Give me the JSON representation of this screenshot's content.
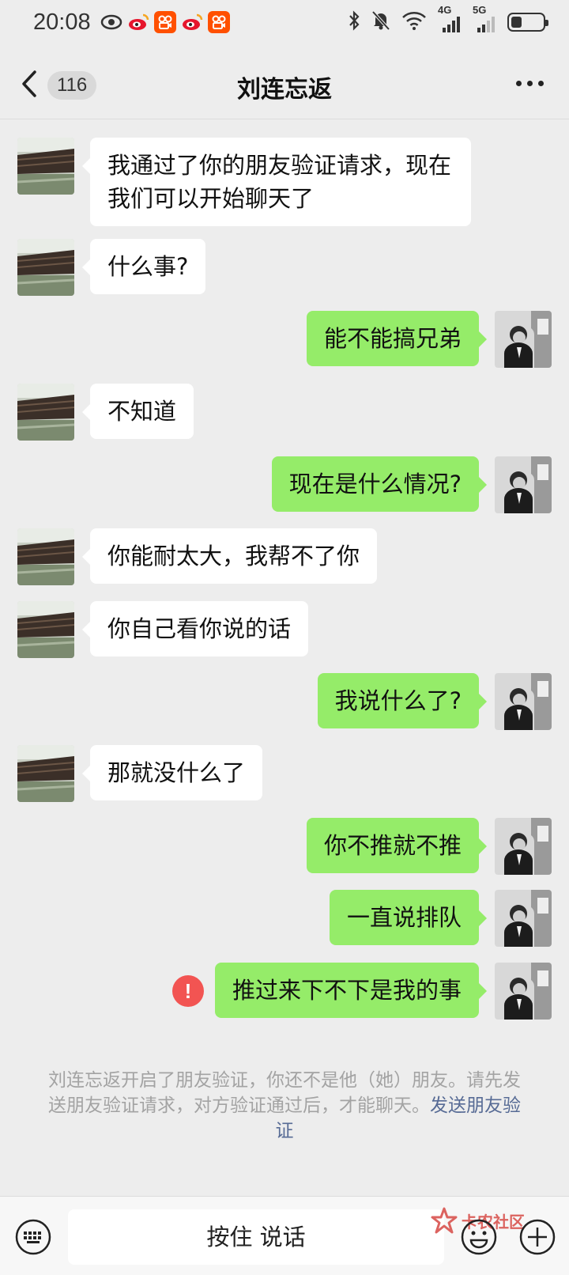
{
  "status_bar": {
    "time": "20:08",
    "net1": "4G",
    "net2": "5G"
  },
  "header": {
    "unread_count": "116",
    "title": "刘连忘返"
  },
  "messages": [
    {
      "side": "left",
      "text": "我通过了你的朋友验证请求，现在我们可以开始聊天了"
    },
    {
      "side": "left",
      "text": "什么事?"
    },
    {
      "side": "right",
      "text": "能不能搞兄弟"
    },
    {
      "side": "left",
      "text": "不知道"
    },
    {
      "side": "right",
      "text": "现在是什么情况?"
    },
    {
      "side": "left",
      "text": "你能耐太大，我帮不了你"
    },
    {
      "side": "left",
      "text": "你自己看你说的话"
    },
    {
      "side": "right",
      "text": "我说什么了?"
    },
    {
      "side": "left",
      "text": "那就没什么了"
    },
    {
      "side": "right",
      "text": "你不推就不推"
    },
    {
      "side": "right",
      "text": "一直说排队"
    },
    {
      "side": "right",
      "text": "推过来下不下是我的事",
      "failed": true,
      "fail_mark": "!"
    }
  ],
  "system_notice": {
    "text": "刘连忘返开启了朋友验证，你还不是他（她）朋友。请先发送朋友验证请求，对方验证通过后，才能聊天。",
    "link": "发送朋友验证"
  },
  "input_bar": {
    "voice_label": "按住 说话",
    "watermark": "卡农社区"
  },
  "icons": {
    "back": "chevron-left-icon",
    "more": "more-dots-icon",
    "keyboard": "keyboard-icon",
    "emoji": "emoji-icon",
    "plus": "plus-icon"
  },
  "colors": {
    "background": "#ededed",
    "bubble_self": "#95ec69",
    "bubble_other": "#ffffff",
    "fail": "#f25452",
    "link": "#576b95"
  }
}
